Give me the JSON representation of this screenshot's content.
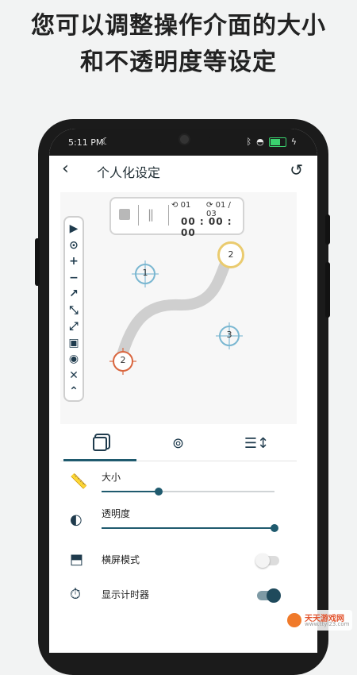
{
  "headline": {
    "line1": "您可以调整操作介面的大小",
    "line2": "和不透明度等设定"
  },
  "statusbar": {
    "time": "5:11 PM",
    "battery": "99"
  },
  "appbar": {
    "title": "个人化设定"
  },
  "timer": {
    "loop_current": "01",
    "loop_total": "01 / 03",
    "clock": "00 : 00 : 00"
  },
  "targets": {
    "t1": "1",
    "t2_end": "2",
    "t3": "3",
    "t2_start": "2"
  },
  "settings": {
    "size_label": "大小",
    "size_value": 0.33,
    "opacity_label": "透明度",
    "opacity_value": 1.0,
    "landscape_label": "横屏模式",
    "landscape_on": false,
    "show_timer_label": "显示计时器",
    "show_timer_on": true
  },
  "colors": {
    "accent": "#1f5a6e",
    "target_blue": "#7ab7d1",
    "target_red": "#d9663f",
    "target_gold": "#eacb6f"
  },
  "watermark": {
    "title": "天天游戏网",
    "url": "www.ttyl23.com"
  }
}
